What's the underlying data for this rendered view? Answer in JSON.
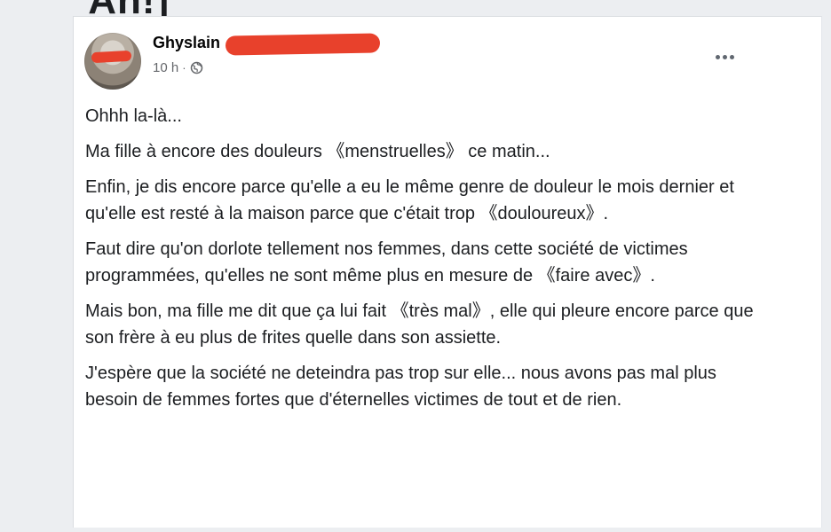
{
  "page": {
    "cut_heading": "’Ah!]"
  },
  "post": {
    "author_visible_name": "Ghyslain",
    "time_ago": "10 h",
    "separator": "·",
    "privacy_icon": "globe-icon",
    "more_icon": "more-horizontal-icon",
    "paragraphs": [
      "Ohhh la-là...",
      "Ma fille à encore des douleurs 《menstruelles》 ce matin...",
      "Enfin, je dis encore parce qu'elle a eu le même genre de douleur le mois dernier et qu'elle est resté à la maison parce que c'était trop 《douloureux》.",
      "Faut dire qu'on dorlote tellement nos femmes, dans cette société de victimes programmées, qu'elles ne sont même plus en mesure de 《faire avec》.",
      "Mais bon, ma fille me dit que ça lui fait 《très mal》, elle qui pleure encore parce que son frère à eu plus de frites quelle dans son assiette.",
      "J'espère que la société ne deteindra pas trop sur elle... nous avons pas mal plus besoin de femmes fortes que d'éternelles victimes de tout et de rien."
    ]
  },
  "colors": {
    "redaction": "#e8412c",
    "text": "#1c1e21",
    "meta_text": "#65676b"
  }
}
